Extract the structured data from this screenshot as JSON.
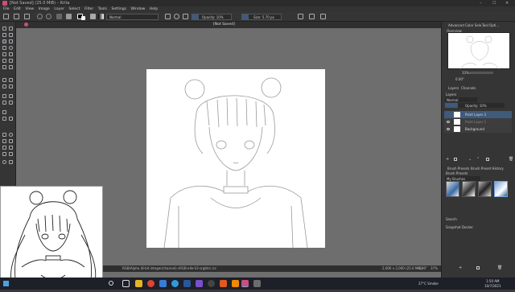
{
  "window": {
    "title": "[Not Saved] (25.0 MiB) – Krita",
    "controls": [
      "–",
      "☐",
      "✕"
    ]
  },
  "menu": [
    "File",
    "Edit",
    "View",
    "Image",
    "Layer",
    "Select",
    "Filter",
    "Tools",
    "Settings",
    "Window",
    "Help"
  ],
  "toolbar": {
    "blend_mode": "Normal",
    "opacity_label": "Opacity: 10%",
    "size_label": "Size: 5.70 px"
  },
  "document_tab": "[Not Saved]",
  "status": {
    "color_model": "RGB/Alpha (8-bit integer/channel)  sRGB-elle-V2-srgbtrc.icc",
    "dimensions": "2,000 x 2,000 (25.0 MiB)",
    "zoom": "6.36°",
    "zoom_pct": "37%"
  },
  "dock": {
    "top_tabs": [
      "Advanced Color Sele...",
      "Tool Opti..."
    ],
    "overview_label": "Overview",
    "zoom_value": "33%",
    "rotation_value": "0.00°",
    "layer_tabs": [
      "Layers",
      "Channels"
    ],
    "layers_header": "Layers",
    "layer_blend": "Normal",
    "layer_opacity": "Opacity: 10%",
    "layers": [
      {
        "name": "Paint Layer 2",
        "selected": true
      },
      {
        "name": "Paint Layer 1",
        "selected": false
      },
      {
        "name": "Background",
        "selected": false
      }
    ],
    "brush_tabs": [
      "Brush Presets",
      "Brush Preset History"
    ],
    "brush_presets_label": "Brush Presets",
    "brush_tag": "My Brushes",
    "search_label": "Search",
    "snapshot_label": "Snapshot Docker"
  },
  "taskbar": {
    "weather": "27°C  Smoke",
    "time": "1:50 AM",
    "date": "10/7/2021"
  },
  "colors": {
    "canvas_bg": "#6e6e6e",
    "panel_bg": "#353535",
    "accent": "#3f5a7a",
    "taskbar": "#1d1f29"
  }
}
